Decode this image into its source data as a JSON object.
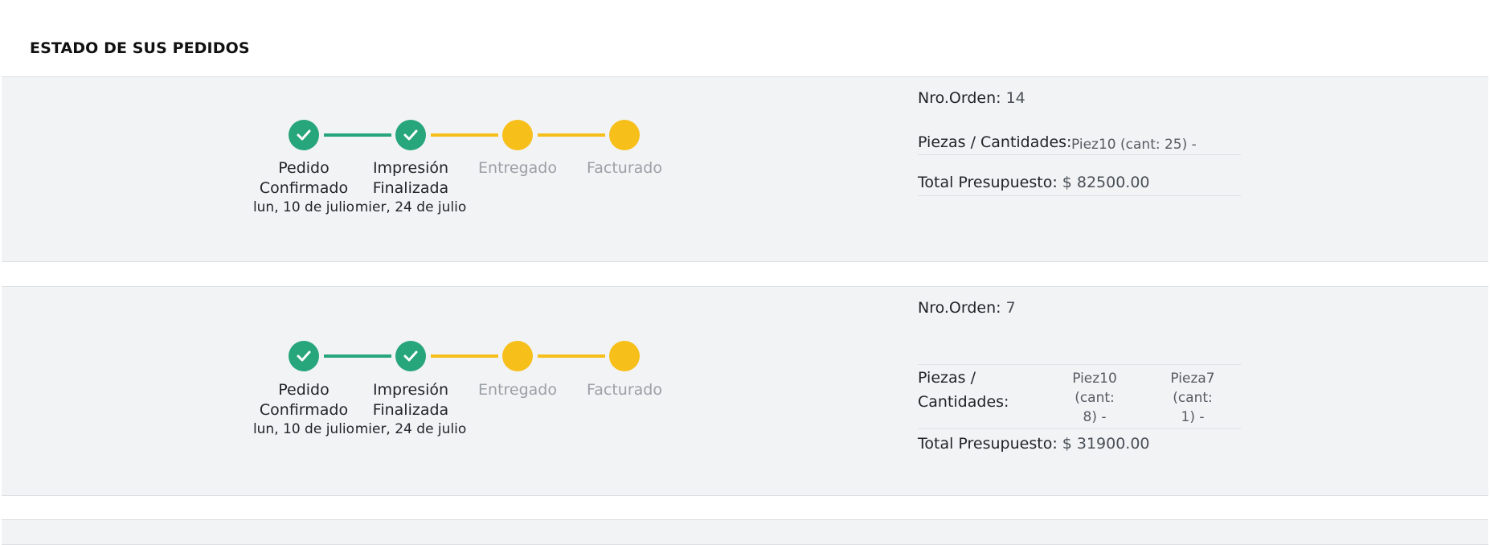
{
  "page": {
    "title": "ESTADO DE SUS PEDIDOS"
  },
  "labels": {
    "order_number": "Nro.Orden:",
    "pieces": "Piezas / Cantidades:",
    "pieces_line1": "Piezas /",
    "pieces_line2": "Cantidades:",
    "total": "Total Presupuesto:"
  },
  "colors": {
    "done": "#27a57b",
    "pending": "#f7bf1a",
    "card_bg": "#f2f3f5"
  },
  "orders": [
    {
      "order_number": "14",
      "pieces": [
        "Piez10 (cant: 25) -"
      ],
      "total": "$ 82500.00",
      "steps": [
        {
          "line1": "Pedido",
          "line2": "Confirmado",
          "date": "lun, 10 de julio",
          "status": "done",
          "icon": "check-icon"
        },
        {
          "line1": "Impresión",
          "line2": "Finalizada",
          "date": "mier, 24 de julio",
          "status": "done",
          "icon": "check-icon"
        },
        {
          "line1": "Entregado",
          "line2": "",
          "date": "",
          "status": "pending"
        },
        {
          "line1": "Facturado",
          "line2": "",
          "date": "",
          "status": "pending"
        }
      ]
    },
    {
      "order_number": "7",
      "pieces": [
        {
          "line1": "Piez10 (cant:",
          "line2": "8) -"
        },
        {
          "line1": "Pieza7 (cant:",
          "line2": "1) -"
        }
      ],
      "total": "$ 31900.00",
      "steps": [
        {
          "line1": "Pedido",
          "line2": "Confirmado",
          "date": "lun, 10 de julio",
          "status": "done",
          "icon": "check-icon"
        },
        {
          "line1": "Impresión",
          "line2": "Finalizada",
          "date": "mier, 24 de julio",
          "status": "done",
          "icon": "check-icon"
        },
        {
          "line1": "Entregado",
          "line2": "",
          "date": "",
          "status": "pending"
        },
        {
          "line1": "Facturado",
          "line2": "",
          "date": "",
          "status": "pending"
        }
      ]
    }
  ]
}
